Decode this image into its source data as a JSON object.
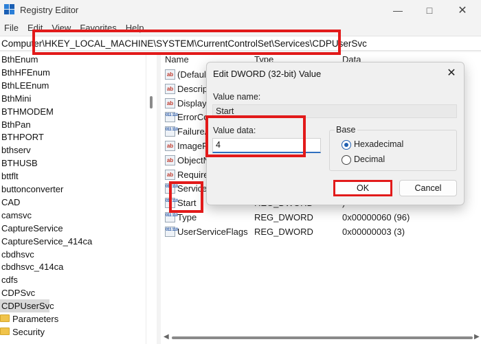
{
  "window": {
    "title": "Registry Editor",
    "minimize_icon": "minimize-icon",
    "maximize_icon": "maximize-icon",
    "close_icon": "close-icon"
  },
  "menu": {
    "file": "File",
    "edit": "Edit",
    "view": "View",
    "favorites": "Favorites",
    "help": "Help"
  },
  "address": {
    "path": "Computer\\HKEY_LOCAL_MACHINE\\SYSTEM\\CurrentControlSet\\Services\\CDPUserSvc"
  },
  "tree": {
    "items": [
      "BthEnum",
      "BthHFEnum",
      "BthLEEnum",
      "BthMini",
      "BTHMODEM",
      "BthPan",
      "BTHPORT",
      "bthserv",
      "BTHUSB",
      "bttflt",
      "buttonconverter",
      "CAD",
      "camsvc",
      "CaptureService",
      "CaptureService_414ca",
      "cbdhsvc",
      "cbdhsvc_414ca",
      "cdfs",
      "CDPSvc",
      "CDPUserSvc"
    ],
    "selected": "CDPUserSvc",
    "children": [
      "Parameters",
      "Security"
    ]
  },
  "values_panel": {
    "headers": {
      "name": "Name",
      "type": "Type",
      "data": "Data"
    },
    "rows": [
      {
        "icon": "string",
        "name": "(Default)",
        "type": "",
        "data": ""
      },
      {
        "icon": "string",
        "name": "Description",
        "type": "",
        "data": "pse"
      },
      {
        "icon": "string",
        "name": "DisplayName",
        "type": "",
        "data": "pse"
      },
      {
        "icon": "binary",
        "name": "ErrorControl",
        "type": "",
        "data": ""
      },
      {
        "icon": "binary",
        "name": "FailureActions",
        "type": "",
        "data": "0 00"
      },
      {
        "icon": "string",
        "name": "ImagePath",
        "type": "",
        "data": "ost.e"
      },
      {
        "icon": "string",
        "name": "ObjectName",
        "type": "",
        "data": ""
      },
      {
        "icon": "string",
        "name": "RequiredPrivileges",
        "type": "",
        "data": ""
      },
      {
        "icon": "binary",
        "name": "ServiceSidType",
        "type": "",
        "data": ""
      },
      {
        "icon": "binary",
        "name": "Start",
        "type": "REG_DWORD",
        "data": ")"
      },
      {
        "icon": "binary",
        "name": "Type",
        "type": "REG_DWORD",
        "data": "0x00000060 (96)"
      },
      {
        "icon": "binary",
        "name": "UserServiceFlags",
        "type": "REG_DWORD",
        "data": "0x00000003 (3)"
      }
    ]
  },
  "dialog": {
    "title": "Edit DWORD (32-bit) Value",
    "value_name_label": "Value name:",
    "value_name": "Start",
    "value_data_label": "Value data:",
    "value_data": "4",
    "base_label": "Base",
    "hex_label": "Hexadecimal",
    "dec_label": "Decimal",
    "hex_selected": true,
    "ok_label": "OK",
    "cancel_label": "Cancel"
  },
  "colors": {
    "highlight": "#e21a1a",
    "accent": "#2f6fbf",
    "selection": "#d9d9d9"
  }
}
